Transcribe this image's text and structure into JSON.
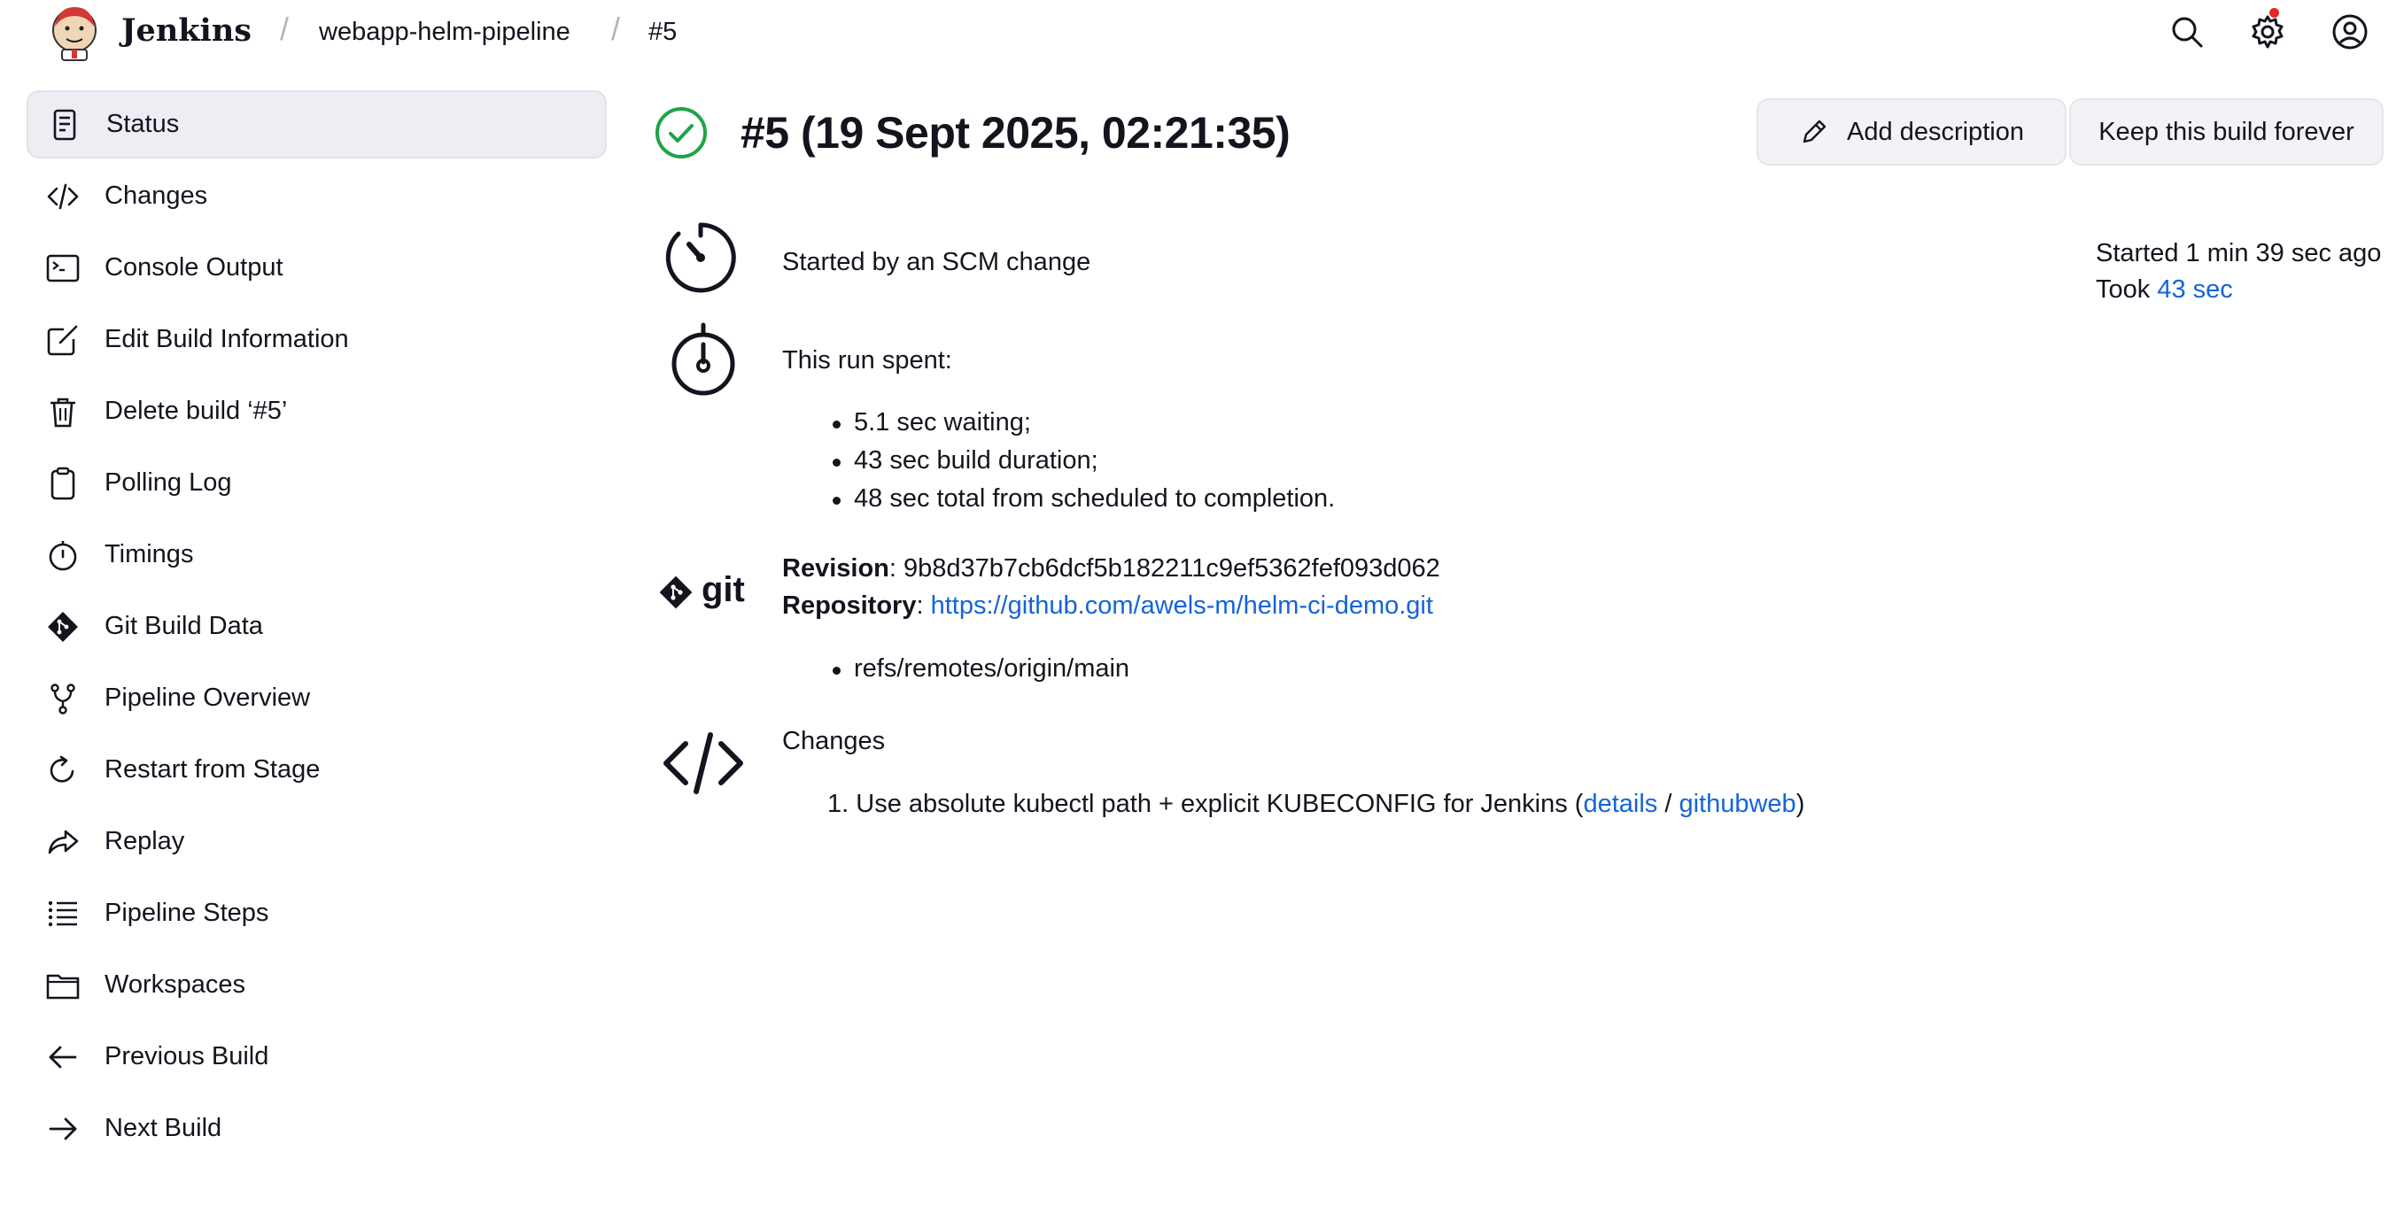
{
  "header": {
    "brand": "Jenkins",
    "breadcrumbs": [
      "webapp-helm-pipeline",
      "#5"
    ],
    "separator": "/",
    "icons": [
      "search-icon",
      "gear-icon",
      "user-icon"
    ]
  },
  "sidebar": {
    "items": [
      {
        "label": "Status",
        "icon": "status-icon",
        "active": true
      },
      {
        "label": "Changes",
        "icon": "code-icon"
      },
      {
        "label": "Console Output",
        "icon": "terminal-icon"
      },
      {
        "label": "Edit Build Information",
        "icon": "edit-icon"
      },
      {
        "label": "Delete build ‘#5’",
        "icon": "trash-icon"
      },
      {
        "label": "Polling Log",
        "icon": "clipboard-icon"
      },
      {
        "label": "Timings",
        "icon": "stopwatch-icon"
      },
      {
        "label": "Git Build Data",
        "icon": "git-icon"
      },
      {
        "label": "Pipeline Overview",
        "icon": "pipeline-icon"
      },
      {
        "label": "Restart from Stage",
        "icon": "restart-icon"
      },
      {
        "label": "Replay",
        "icon": "replay-icon"
      },
      {
        "label": "Pipeline Steps",
        "icon": "list-icon"
      },
      {
        "label": "Workspaces",
        "icon": "folder-icon"
      },
      {
        "label": "Previous Build",
        "icon": "arrow-left-icon"
      },
      {
        "label": "Next Build",
        "icon": "arrow-right-icon"
      }
    ]
  },
  "main": {
    "title": "#5 (19 Sept 2025, 02:21:35)",
    "buttons": {
      "add_description": "Add description",
      "keep_forever": "Keep this build forever"
    },
    "started_by": "Started by an SCM change",
    "started_ago": "Started 1 min 39 sec ago",
    "took_prefix": "Took ",
    "took_value": "43 sec",
    "run_spent": "This run spent:",
    "run_items": [
      "5.1 sec waiting;",
      "43 sec build duration;",
      "48 sec total from scheduled to completion."
    ],
    "revision_label": "Revision",
    "revision_value": ": 9b8d37b7cb6dcf5b182211c9ef5362fef093d062",
    "repository_label": "Repository",
    "repository_sep": ": ",
    "repository_url": "https://github.com/awels-m/helm-ci-demo.git",
    "refs": [
      "refs/remotes/origin/main"
    ],
    "git_logo_text": "git",
    "changes_heading": "Changes",
    "change_number": "1.",
    "change_text": "Use absolute kubectl path + explicit KUBECONFIG for Jenkins (",
    "change_link_details": "details",
    "change_sep": " / ",
    "change_link_githubweb": "githubweb",
    "change_close": ")"
  },
  "colors": {
    "link": "#1464d7",
    "success": "#1ea446",
    "active_bg": "#eceef3",
    "notify": "#e6282d"
  }
}
